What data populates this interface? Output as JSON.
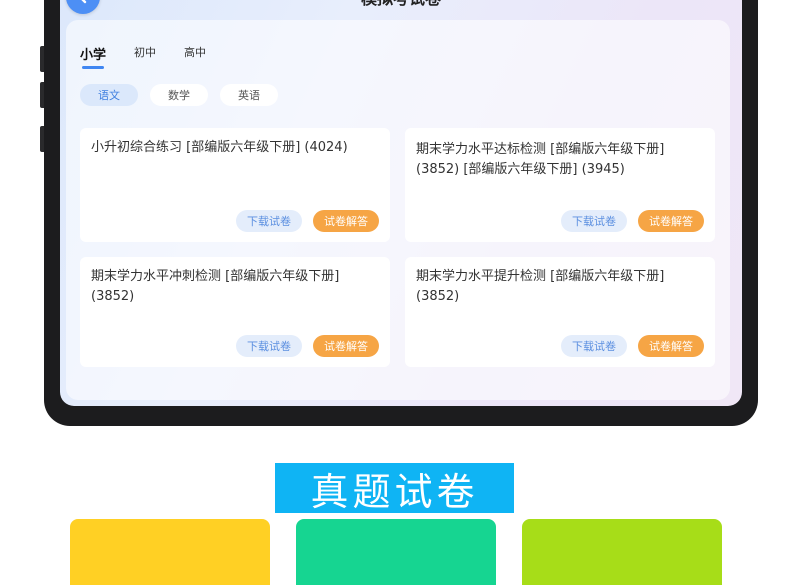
{
  "screen": {
    "title": "模拟考试卷",
    "back_icon": "chevron-left-icon"
  },
  "level_tabs": [
    {
      "label": "小学",
      "active": true
    },
    {
      "label": "初中",
      "active": false
    },
    {
      "label": "高中",
      "active": false
    }
  ],
  "subject_tabs": [
    {
      "label": "语文",
      "active": true
    },
    {
      "label": "数学",
      "active": false
    },
    {
      "label": "英语",
      "active": false
    }
  ],
  "cards": [
    {
      "title": "小升初综合练习 [部编版六年级下册] (4024)",
      "download_label": "下载试卷",
      "answer_label": "试卷解答"
    },
    {
      "title": "期末学力水平达标检测 [部编版六年级下册] (3852) [部编版六年级下册] (3945)",
      "download_label": "下载试卷",
      "answer_label": "试卷解答"
    },
    {
      "title": "期末学力水平冲刺检测 [部编版六年级下册] (3852)",
      "download_label": "下载试卷",
      "answer_label": "试卷解答"
    },
    {
      "title": "期末学力水平提升检测 [部编版六年级下册] (3852)",
      "download_label": "下载试卷",
      "answer_label": "试卷解答"
    }
  ],
  "section": {
    "title": "真题试卷"
  },
  "colors": {
    "accent_blue": "#3f86f2",
    "answer_orange": "#f6a545",
    "section_blue": "#0fb4f4",
    "tile_yellow": "#ffd024",
    "tile_green": "#16d591",
    "tile_lime": "#a7dd18"
  }
}
